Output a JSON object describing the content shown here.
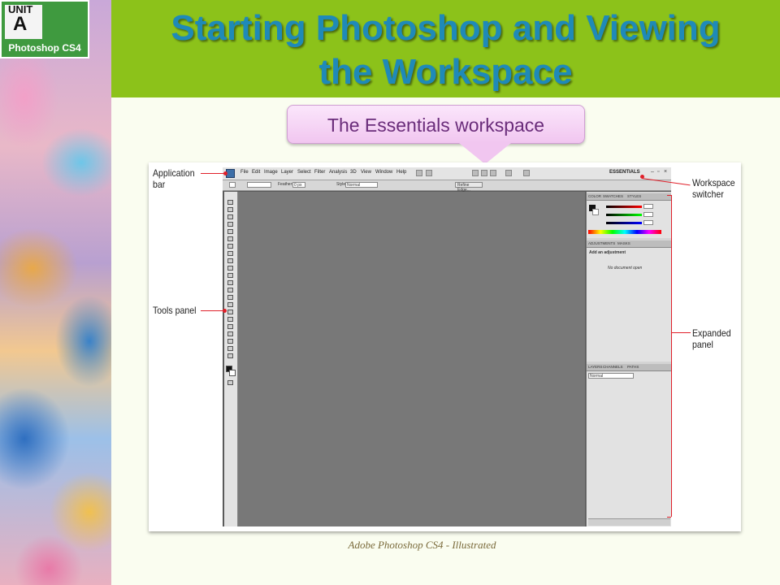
{
  "unit_badge": {
    "unit_word": "UNIT",
    "unit_letter": "A",
    "product": "Photoshop CS4"
  },
  "title": {
    "line1": "Starting Photoshop and Viewing",
    "line2": "the Workspace"
  },
  "callout": "The Essentials workspace",
  "photoshop": {
    "menu": [
      "File",
      "Edit",
      "Image",
      "Layer",
      "Select",
      "Filter",
      "Analysis",
      "3D",
      "View",
      "Window",
      "Help"
    ],
    "workspace_label": "ESSENTIALS",
    "options_bar": {
      "feather_label": "Feather:",
      "feather_value": "0 px",
      "style_label": "Style:",
      "style_value": "Normal",
      "refine_button": "Refine Edge..."
    },
    "panels": {
      "color_tabs": [
        "COLOR",
        "SWATCHES",
        "STYLES"
      ],
      "adjust_tabs": [
        "ADJUSTMENTS",
        "MASKS"
      ],
      "add_adjustment": "Add an adjustment",
      "no_document": "No document open",
      "layers_tabs": [
        "LAYERS",
        "CHANNELS",
        "PATHS"
      ],
      "blend_mode": "Normal"
    }
  },
  "annotations": {
    "application_bar": [
      "Application",
      "bar"
    ],
    "tools_panel": "Tools panel",
    "workspace_switcher": [
      "Workspace",
      "switcher"
    ],
    "expanded_panel": [
      "Expanded",
      "panel"
    ]
  },
  "colors": {
    "title_band": "#8cc21a",
    "title_text": "#1f8ab8",
    "callout_fill": "#f1c6f0",
    "annotation_line": "#e0202a"
  },
  "footer": "Adobe Photoshop CS4 - Illustrated"
}
